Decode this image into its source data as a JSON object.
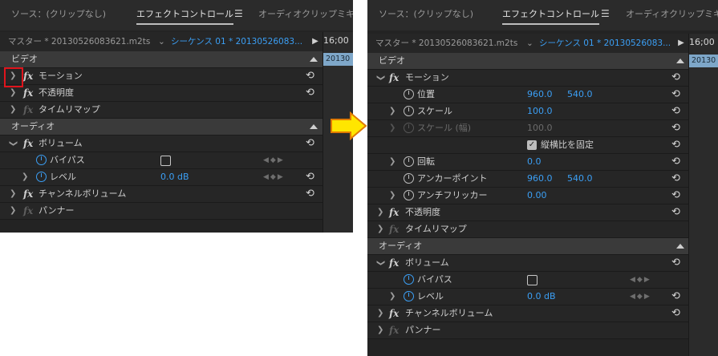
{
  "left_panel": {
    "tabs": {
      "source": "ソース：(クリップなし)",
      "effect": "エフェクトコントロール",
      "audio": "オーディオクリップミキサ"
    },
    "menu_icon": "hamburger-icon",
    "source_bar": {
      "master": "マスター * 20130526083621.m2ts",
      "sequence": "シーケンス 01 * 20130526083..."
    },
    "timeline": {
      "time": "16;00",
      "clip": "20130"
    },
    "sections": {
      "video": "ビデオ",
      "audio": "オーディオ"
    },
    "effects": {
      "motion": "モーション",
      "opacity": "不透明度",
      "time_remap": "タイムリマップ",
      "volume": "ボリューム",
      "bypass": "バイパス",
      "level": "レベル",
      "level_value": "0.0 dB",
      "channel_volume": "チャンネルボリューム",
      "panner": "パンナー"
    }
  },
  "right_panel": {
    "tabs": {
      "source": "ソース：(クリップなし)",
      "effect": "エフェクトコントロール",
      "audio": "オーディオクリップミキサ"
    },
    "source_bar": {
      "master": "マスター * 20130526083621.m2ts",
      "sequence": "シーケンス 01 * 20130526083..."
    },
    "timeline": {
      "time": "16;00",
      "clip": "20130"
    },
    "sections": {
      "video": "ビデオ",
      "audio": "オーディオ"
    },
    "effects": {
      "motion": "モーション",
      "position": "位置",
      "position_x": "960.0",
      "position_y": "540.0",
      "scale": "スケール",
      "scale_value": "100.0",
      "scale_width": "スケール (幅)",
      "scale_width_value": "100.0",
      "uniform_scale": "縦横比を固定",
      "rotation": "回転",
      "rotation_value": "0.0",
      "anchor": "アンカーポイント",
      "anchor_x": "960.0",
      "anchor_y": "540.0",
      "anti_flicker": "アンチフリッカー",
      "anti_flicker_value": "0.00",
      "opacity": "不透明度",
      "time_remap": "タイムリマップ",
      "volume": "ボリューム",
      "bypass": "バイパス",
      "level": "レベル",
      "level_value": "0.0 dB",
      "channel_volume": "チャンネルボリューム",
      "panner": "パンナー"
    }
  },
  "annotations": {
    "highlight_color": "#e0141c",
    "arrow_color": "#ffe600",
    "arrow_border": "#e07a00"
  }
}
